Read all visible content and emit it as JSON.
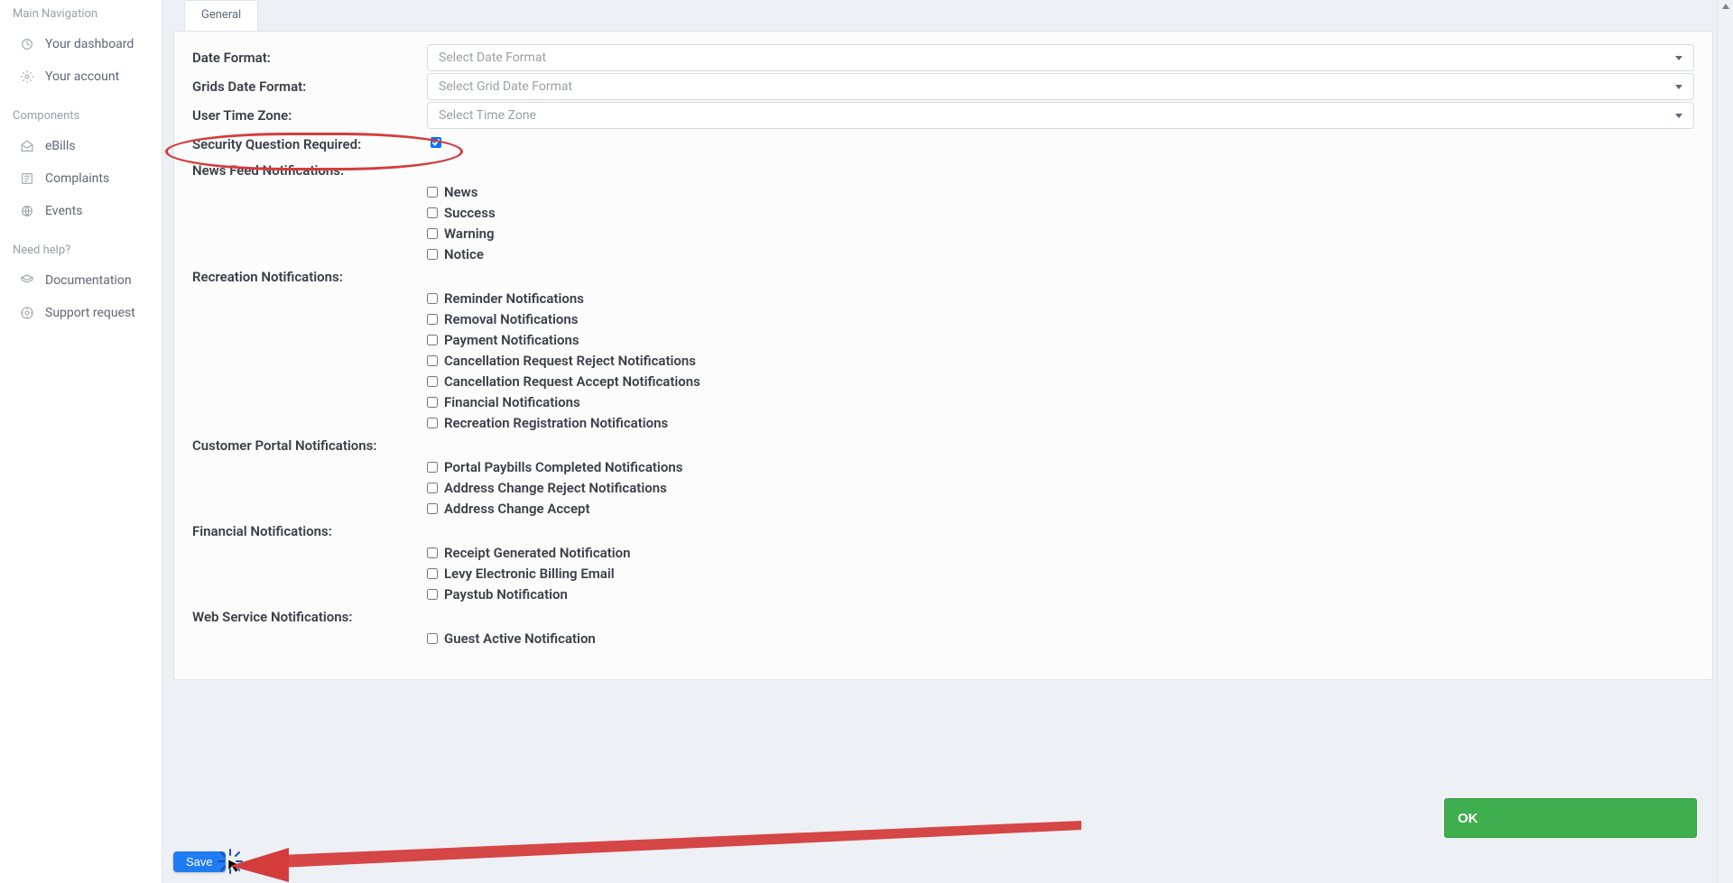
{
  "sidebar": {
    "section_main": "Main Navigation",
    "items_main": [
      {
        "label": "Your dashboard",
        "icon": "dashboard-icon"
      },
      {
        "label": "Your account",
        "icon": "user-icon"
      }
    ],
    "section_components": "Components",
    "items_components": [
      {
        "label": "eBills",
        "icon": "ebills-icon"
      },
      {
        "label": "Complaints",
        "icon": "complaints-icon"
      },
      {
        "label": "Events",
        "icon": "events-icon"
      }
    ],
    "section_help": "Need help?",
    "items_help": [
      {
        "label": "Documentation",
        "icon": "doc-icon"
      },
      {
        "label": "Support request",
        "icon": "support-icon"
      }
    ]
  },
  "tabs": {
    "general": "General"
  },
  "form": {
    "date_format": {
      "label": "Date Format:",
      "placeholder": "Select Date Format"
    },
    "grids_date_format": {
      "label": "Grids Date Format:",
      "placeholder": "Select Grid Date Format"
    },
    "user_time_zone": {
      "label": "User Time Zone:",
      "placeholder": "Select Time Zone"
    },
    "security_question": {
      "label": "Security Question Required:",
      "checked": true
    },
    "news_feed": {
      "title": "News Feed Notifications:",
      "items": [
        "News",
        "Success",
        "Warning",
        "Notice"
      ]
    },
    "recreation": {
      "title": "Recreation Notifications:",
      "items": [
        "Reminder Notifications",
        "Removal Notifications",
        "Payment Notifications",
        "Cancellation Request Reject Notifications",
        "Cancellation Request Accept Notifications",
        "Financial Notifications",
        "Recreation Registration Notifications"
      ]
    },
    "customer_portal": {
      "title": "Customer Portal Notifications:",
      "items": [
        "Portal Paybills Completed Notifications",
        "Address Change Reject Notifications",
        "Address Change Accept"
      ]
    },
    "financial": {
      "title": "Financial Notifications:",
      "items": [
        "Receipt Generated Notification",
        "Levy Electronic Billing Email",
        "Paystub Notification"
      ]
    },
    "web_service": {
      "title": "Web Service Notifications:",
      "items": [
        "Guest Active Notification"
      ]
    }
  },
  "buttons": {
    "save": "Save",
    "ok": "OK"
  },
  "annotation": {
    "highlight_field": "security_question",
    "arrow_color": "#d43c3c"
  }
}
